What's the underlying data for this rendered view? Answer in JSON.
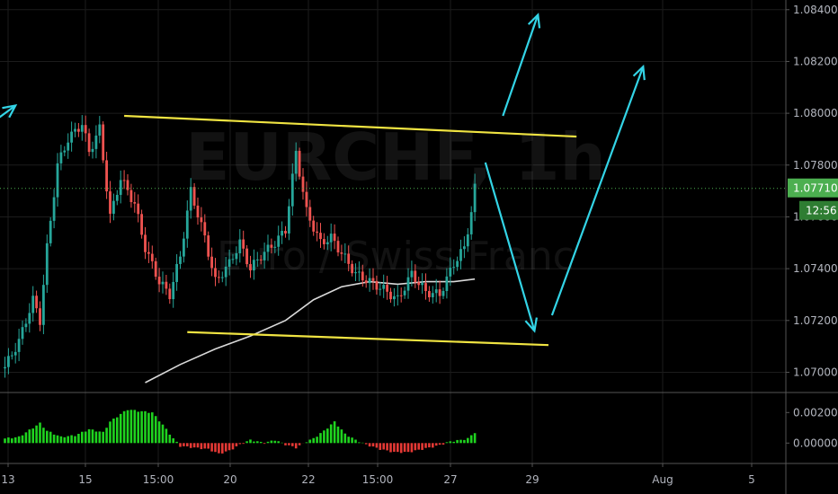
{
  "colors": {
    "background": "#000000",
    "grid": "#1c1c1c",
    "up": "#26a69a",
    "down": "#ef5350",
    "trendline": "#f0e442",
    "arrow": "#33d4e6",
    "ma": "#d9d9d9",
    "price_tag": "#4caf50",
    "osc_up": "#1fd31f",
    "osc_down": "#e53935"
  },
  "watermark": {
    "symbol": "EURCHF, 1h",
    "description": "Euro / Swiss Franc"
  },
  "chart_data": [
    {
      "type": "candlestick",
      "symbol": "EURCHF",
      "interval": "1h",
      "y_axis_ticks": [
        "1.08400",
        "1.08200",
        "1.08000",
        "1.07800",
        "1.07600",
        "1.07400",
        "1.07200",
        "1.07000"
      ],
      "ylim": [
        1.0696,
        1.0842
      ],
      "x_axis_ticks": [
        "13",
        "15",
        "15:00",
        "20",
        "22",
        "15:00",
        "27",
        "29",
        "Aug",
        "5"
      ],
      "last_price": "1.07710",
      "countdown": "12:56",
      "price_path": [
        [
          0,
          1.0702
        ],
        [
          4,
          1.0712
        ],
        [
          8,
          1.0728
        ],
        [
          10,
          1.072
        ],
        [
          12,
          1.0748
        ],
        [
          15,
          1.078
        ],
        [
          18,
          1.079
        ],
        [
          22,
          1.0796
        ],
        [
          24,
          1.0785
        ],
        [
          27,
          1.0794
        ],
        [
          30,
          1.076
        ],
        [
          33,
          1.0775
        ],
        [
          37,
          1.0765
        ],
        [
          40,
          1.0748
        ],
        [
          44,
          1.0735
        ],
        [
          47,
          1.073
        ],
        [
          50,
          1.0745
        ],
        [
          53,
          1.077
        ],
        [
          57,
          1.0752
        ],
        [
          60,
          1.0735
        ],
        [
          64,
          1.0742
        ],
        [
          67,
          1.075
        ],
        [
          70,
          1.074
        ],
        [
          73,
          1.0745
        ],
        [
          77,
          1.075
        ],
        [
          80,
          1.0755
        ],
        [
          83,
          1.0785
        ],
        [
          86,
          1.0762
        ],
        [
          90,
          1.075
        ],
        [
          93,
          1.0752
        ],
        [
          97,
          1.0744
        ],
        [
          100,
          1.0738
        ],
        [
          104,
          1.0735
        ],
        [
          108,
          1.0732
        ],
        [
          112,
          1.0728
        ],
        [
          116,
          1.0738
        ],
        [
          120,
          1.0731
        ],
        [
          124,
          1.073
        ],
        [
          128,
          1.0742
        ],
        [
          131,
          1.0748
        ],
        [
          133,
          1.0762
        ],
        [
          134,
          1.0771
        ]
      ],
      "moving_average": [
        [
          40,
          1.0696
        ],
        [
          50,
          1.0703
        ],
        [
          60,
          1.0709
        ],
        [
          70,
          1.0714
        ],
        [
          80,
          1.072
        ],
        [
          88,
          1.0728
        ],
        [
          96,
          1.0733
        ],
        [
          104,
          1.0735
        ],
        [
          112,
          1.0734
        ],
        [
          120,
          1.0735
        ],
        [
          128,
          1.0735
        ],
        [
          134,
          1.0736
        ]
      ],
      "annotations": {
        "upper_trendline": [
          [
            34,
            1.0799
          ],
          [
            163,
            1.0791
          ]
        ],
        "lower_trendline": [
          [
            52,
            1.07155
          ],
          [
            155,
            1.07105
          ]
        ],
        "arrows": [
          {
            "from": [
              -2,
              1.0798
            ],
            "to": [
              3,
              1.0803
            ]
          },
          {
            "from": [
              142,
              1.0799
            ],
            "to": [
              152,
              1.0838
            ]
          },
          {
            "from": [
              137,
              1.0781
            ],
            "to": [
              151,
              1.0716
            ]
          },
          {
            "from": [
              156,
              1.0722
            ],
            "to": [
              182,
              1.0818
            ]
          }
        ]
      },
      "oscillator": {
        "y_axis_ticks": [
          "0.00200",
          "0.00000"
        ],
        "ylim": [
          -0.0011,
          0.0029
        ],
        "values": [
          [
            0,
            0.0003
          ],
          [
            4,
            0.0004
          ],
          [
            8,
            0.001
          ],
          [
            10,
            0.0013
          ],
          [
            12,
            0.0008
          ],
          [
            16,
            0.0004
          ],
          [
            20,
            0.0005
          ],
          [
            24,
            0.0009
          ],
          [
            28,
            0.0007
          ],
          [
            30,
            0.0014
          ],
          [
            33,
            0.0019
          ],
          [
            35,
            0.0022
          ],
          [
            38,
            0.0021
          ],
          [
            42,
            0.002
          ],
          [
            45,
            0.0012
          ],
          [
            48,
            0.0003
          ],
          [
            50,
            -0.0002
          ],
          [
            54,
            -0.0003
          ],
          [
            58,
            -0.0004
          ],
          [
            61,
            -0.0007
          ],
          [
            64,
            -0.0005
          ],
          [
            67,
            -0.0001
          ],
          [
            70,
            0.0002
          ],
          [
            74,
            0.0
          ],
          [
            77,
            0.0002
          ],
          [
            80,
            -0.0001
          ],
          [
            83,
            -0.0003
          ],
          [
            86,
            0.0001
          ],
          [
            88,
            0.0003
          ],
          [
            91,
            0.0008
          ],
          [
            94,
            0.0014
          ],
          [
            97,
            0.0006
          ],
          [
            100,
            0.0002
          ],
          [
            103,
            -0.0001
          ],
          [
            107,
            -0.0004
          ],
          [
            111,
            -0.0006
          ],
          [
            115,
            -0.0006
          ],
          [
            119,
            -0.0004
          ],
          [
            123,
            -0.0002
          ],
          [
            127,
            0.0001
          ],
          [
            130,
            0.0002
          ],
          [
            132,
            0.0003
          ],
          [
            134,
            0.0007
          ]
        ]
      }
    }
  ]
}
